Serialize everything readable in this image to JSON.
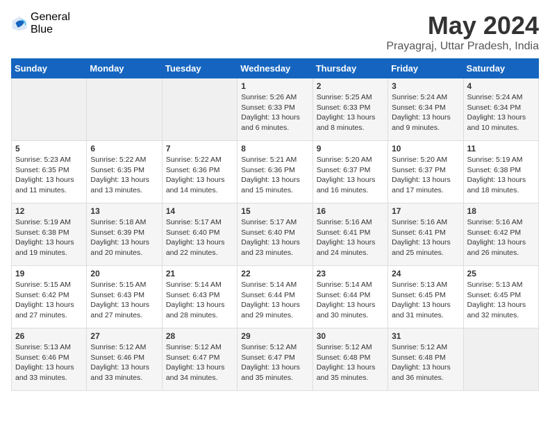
{
  "logo": {
    "general": "General",
    "blue": "Blue"
  },
  "title": "May 2024",
  "subtitle": "Prayagraj, Uttar Pradesh, India",
  "headers": [
    "Sunday",
    "Monday",
    "Tuesday",
    "Wednesday",
    "Thursday",
    "Friday",
    "Saturday"
  ],
  "weeks": [
    [
      {
        "day": "",
        "info": ""
      },
      {
        "day": "",
        "info": ""
      },
      {
        "day": "",
        "info": ""
      },
      {
        "day": "1",
        "info": "Sunrise: 5:26 AM\nSunset: 6:33 PM\nDaylight: 13 hours and 6 minutes."
      },
      {
        "day": "2",
        "info": "Sunrise: 5:25 AM\nSunset: 6:33 PM\nDaylight: 13 hours and 8 minutes."
      },
      {
        "day": "3",
        "info": "Sunrise: 5:24 AM\nSunset: 6:34 PM\nDaylight: 13 hours and 9 minutes."
      },
      {
        "day": "4",
        "info": "Sunrise: 5:24 AM\nSunset: 6:34 PM\nDaylight: 13 hours and 10 minutes."
      }
    ],
    [
      {
        "day": "5",
        "info": "Sunrise: 5:23 AM\nSunset: 6:35 PM\nDaylight: 13 hours and 11 minutes."
      },
      {
        "day": "6",
        "info": "Sunrise: 5:22 AM\nSunset: 6:35 PM\nDaylight: 13 hours and 13 minutes."
      },
      {
        "day": "7",
        "info": "Sunrise: 5:22 AM\nSunset: 6:36 PM\nDaylight: 13 hours and 14 minutes."
      },
      {
        "day": "8",
        "info": "Sunrise: 5:21 AM\nSunset: 6:36 PM\nDaylight: 13 hours and 15 minutes."
      },
      {
        "day": "9",
        "info": "Sunrise: 5:20 AM\nSunset: 6:37 PM\nDaylight: 13 hours and 16 minutes."
      },
      {
        "day": "10",
        "info": "Sunrise: 5:20 AM\nSunset: 6:37 PM\nDaylight: 13 hours and 17 minutes."
      },
      {
        "day": "11",
        "info": "Sunrise: 5:19 AM\nSunset: 6:38 PM\nDaylight: 13 hours and 18 minutes."
      }
    ],
    [
      {
        "day": "12",
        "info": "Sunrise: 5:19 AM\nSunset: 6:38 PM\nDaylight: 13 hours and 19 minutes."
      },
      {
        "day": "13",
        "info": "Sunrise: 5:18 AM\nSunset: 6:39 PM\nDaylight: 13 hours and 20 minutes."
      },
      {
        "day": "14",
        "info": "Sunrise: 5:17 AM\nSunset: 6:40 PM\nDaylight: 13 hours and 22 minutes."
      },
      {
        "day": "15",
        "info": "Sunrise: 5:17 AM\nSunset: 6:40 PM\nDaylight: 13 hours and 23 minutes."
      },
      {
        "day": "16",
        "info": "Sunrise: 5:16 AM\nSunset: 6:41 PM\nDaylight: 13 hours and 24 minutes."
      },
      {
        "day": "17",
        "info": "Sunrise: 5:16 AM\nSunset: 6:41 PM\nDaylight: 13 hours and 25 minutes."
      },
      {
        "day": "18",
        "info": "Sunrise: 5:16 AM\nSunset: 6:42 PM\nDaylight: 13 hours and 26 minutes."
      }
    ],
    [
      {
        "day": "19",
        "info": "Sunrise: 5:15 AM\nSunset: 6:42 PM\nDaylight: 13 hours and 27 minutes."
      },
      {
        "day": "20",
        "info": "Sunrise: 5:15 AM\nSunset: 6:43 PM\nDaylight: 13 hours and 27 minutes."
      },
      {
        "day": "21",
        "info": "Sunrise: 5:14 AM\nSunset: 6:43 PM\nDaylight: 13 hours and 28 minutes."
      },
      {
        "day": "22",
        "info": "Sunrise: 5:14 AM\nSunset: 6:44 PM\nDaylight: 13 hours and 29 minutes."
      },
      {
        "day": "23",
        "info": "Sunrise: 5:14 AM\nSunset: 6:44 PM\nDaylight: 13 hours and 30 minutes."
      },
      {
        "day": "24",
        "info": "Sunrise: 5:13 AM\nSunset: 6:45 PM\nDaylight: 13 hours and 31 minutes."
      },
      {
        "day": "25",
        "info": "Sunrise: 5:13 AM\nSunset: 6:45 PM\nDaylight: 13 hours and 32 minutes."
      }
    ],
    [
      {
        "day": "26",
        "info": "Sunrise: 5:13 AM\nSunset: 6:46 PM\nDaylight: 13 hours and 33 minutes."
      },
      {
        "day": "27",
        "info": "Sunrise: 5:12 AM\nSunset: 6:46 PM\nDaylight: 13 hours and 33 minutes."
      },
      {
        "day": "28",
        "info": "Sunrise: 5:12 AM\nSunset: 6:47 PM\nDaylight: 13 hours and 34 minutes."
      },
      {
        "day": "29",
        "info": "Sunrise: 5:12 AM\nSunset: 6:47 PM\nDaylight: 13 hours and 35 minutes."
      },
      {
        "day": "30",
        "info": "Sunrise: 5:12 AM\nSunset: 6:48 PM\nDaylight: 13 hours and 35 minutes."
      },
      {
        "day": "31",
        "info": "Sunrise: 5:12 AM\nSunset: 6:48 PM\nDaylight: 13 hours and 36 minutes."
      },
      {
        "day": "",
        "info": ""
      }
    ]
  ]
}
